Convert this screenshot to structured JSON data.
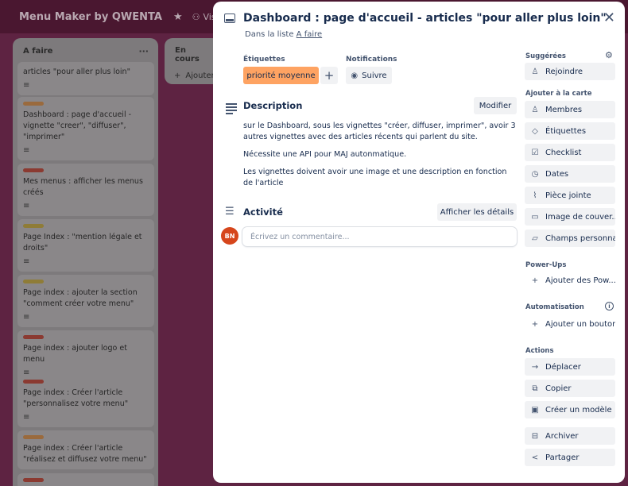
{
  "board": {
    "title": "Menu Maker by QWENTA",
    "star_icon": "star-icon",
    "visibility": "Visible p",
    "lists": [
      {
        "title": "A faire",
        "menu": "···",
        "cards": [
          {
            "text": "articles \"pour aller plus loin\"",
            "label_color": "none"
          },
          {
            "text": "Dashboard : page d'accueil - vignette \"creer\", \"diffuser\", \"imprimer\"",
            "label_color": "orange"
          },
          {
            "text": "Mes menus : afficher les menus créés",
            "label_color": "red"
          },
          {
            "text": "Page Index : \"mention légale et droits\"",
            "label_color": "yellow"
          },
          {
            "text": "Page index : ajouter la section \"comment créer votre menu\"",
            "label_color": "yellow"
          },
          {
            "text": "Page index : ajouter logo et menu",
            "label_color": "red"
          },
          {
            "text": "Page index : Créer l'article \"personnalisez votre menu\"",
            "label_color": "red"
          },
          {
            "text": "Page index : Créer l'article \"réalisez et diffusez votre menu\"",
            "label_color": "orange"
          }
        ]
      },
      {
        "title": "En cours",
        "add_card": "Ajouter"
      }
    ]
  },
  "modal": {
    "title": "Dashboard : page d'accueil - articles \"pour aller plus loin\"",
    "in_list_prefix": "Dans la liste",
    "in_list_link": "A faire",
    "close": "✕",
    "labels_heading": "Étiquettes",
    "label_chip": "priorité moyenne",
    "label_chip_color": "#fea362",
    "add_label": "+",
    "notifications_heading": "Notifications",
    "watch": "Suivre",
    "description": {
      "heading": "Description",
      "edit": "Modifier",
      "paragraphs": [
        "sur le Dashboard, sous les vignettes \"créer, diffuser, imprimer\", avoir 3 autres vignettes avec des articles récents qui parlent du site.",
        "Nécessite une API pour MAJ autonmatique.",
        "Les vignettes doivent avoir une image et une description en fonction de l'article"
      ]
    },
    "activity": {
      "heading": "Activité",
      "show_details": "Afficher les détails",
      "avatar": "BN",
      "avatar_color": "#d6461c",
      "comment_placeholder": "Écrivez un commentaire..."
    },
    "sidebar": {
      "suggested": "Suggérées",
      "join": "Rejoindre",
      "add_to_card": "Ajouter à la carte",
      "add_items": [
        "Membres",
        "Étiquettes",
        "Checklist",
        "Dates",
        "Pièce jointe",
        "Image de couver...",
        "Champs personnal..."
      ],
      "powerups": "Power-Ups",
      "add_powerups": "Ajouter des Pow...",
      "automation": "Automatisation",
      "add_button": "Ajouter un bouton",
      "actions": "Actions",
      "action_items": [
        "Déplacer",
        "Copier",
        "Créer un modèle",
        "Archiver",
        "Partager"
      ]
    }
  }
}
